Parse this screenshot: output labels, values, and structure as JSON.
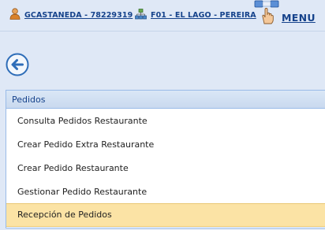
{
  "header": {
    "user_link": "GCASTANEDA - 78229319",
    "branch_link": "F01 - EL LAGO - PEREIRA",
    "menu_label": "MENU"
  },
  "icons": {
    "user": "user-icon",
    "branch": "org-chart-icon",
    "menu": "hand-pointer-icon",
    "back": "arrow-left-circle-icon"
  },
  "panel": {
    "title": "Pedidos",
    "items": [
      {
        "label": "Consulta Pedidos Restaurante",
        "selected": false
      },
      {
        "label": "Crear Pedido Extra Restaurante",
        "selected": false
      },
      {
        "label": "Crear Pedido Restaurante",
        "selected": false
      },
      {
        "label": "Gestionar Pedido Restaurante",
        "selected": false
      },
      {
        "label": "Recepción de Pedidos",
        "selected": true
      }
    ]
  },
  "colors": {
    "background": "#dfe8f6",
    "link": "#15428b",
    "selected_row": "#fbe3a5",
    "panel_border": "#99bbe8"
  }
}
